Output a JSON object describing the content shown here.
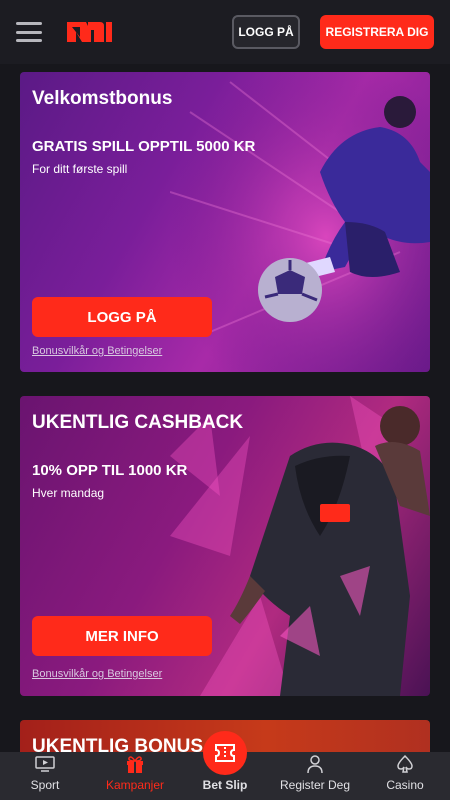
{
  "header": {
    "logo": "N1",
    "login_label": "LOGG PÅ",
    "register_label": "REGISTRERA DIG"
  },
  "cards": [
    {
      "title": "Velkomstbonus",
      "offer": "GRATIS SPILL OPPTIL 5000 KR",
      "subtitle": "For ditt første spill",
      "button_label": "LOGG PÅ",
      "terms_label": "Bonusvilkår og Betingelser"
    },
    {
      "title": "UKENTLIG CASHBACK",
      "offer": "10% OPP TIL 1000 KR",
      "subtitle": "Hver mandag",
      "button_label": "MER INFO",
      "terms_label": "Bonusvilkår og Betingelser"
    },
    {
      "title": "UKENTLIG BONUS"
    }
  ],
  "bottom_nav": {
    "items": [
      {
        "label": "Sport",
        "icon": "tv-icon"
      },
      {
        "label": "Kampanjer",
        "icon": "gift-icon",
        "active": true
      },
      {
        "label": "Bet Slip",
        "icon": "ticket-icon"
      },
      {
        "label": "Register Deg",
        "icon": "user-icon"
      },
      {
        "label": "Casino",
        "icon": "spade-icon"
      }
    ]
  },
  "colors": {
    "accent": "#ff2a1a",
    "background": "#17171c",
    "header": "#1c1c22",
    "nav": "#2a2a30"
  }
}
